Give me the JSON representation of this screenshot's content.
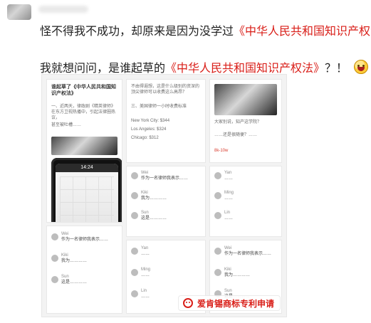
{
  "post": {
    "line1": "怪不得我不成功，却原来是因为没学过",
    "line1_red": "《中华人民共和国知识产权法》",
    "line2": "我就想问问，是谁起草的",
    "line2_red": "《中华人民共和国知识产权法》",
    "line2_tail": "？！"
  },
  "icons": {
    "avatar": "avatar",
    "emoji_1": "grinning-face-icon",
    "emoji_2": "laughing-face-icon",
    "emoji_3": "laughing-face-icon",
    "watermark": "wechat-icon"
  },
  "collage": {
    "tile_a": {
      "title": "谁起草了《中华人民共和国知识产权法》",
      "p1": "一、近两天，律政剧《精英律师》在东方卫视热播中，引起法律圈热议，",
      "p2": "甚至被吐槽……"
    },
    "tile_b": {
      "q": "不由得遐想，这是什么级别的资深的顶尖律师可以收费这么高昂？",
      "s": "三、美国律师一小时收费标准",
      "list": [
        "New York City: $344",
        "Los Angeles: $324",
        "Chicago: $312"
      ]
    },
    "tile_c": {
      "p1": "大家别说，知产这学院？",
      "p2": "……还是很随便？……",
      "hl": "8k-10w"
    },
    "phone": {
      "time": "14:24"
    },
    "comments": [
      {
        "name": "Wei",
        "msg": "作为一名律师我表示……"
      },
      {
        "name": "Kiki",
        "msg": "我为…………"
      },
      {
        "name": "Sun",
        "msg": "这是…………"
      },
      {
        "name": "Yan",
        "msg": "……"
      },
      {
        "name": "Ming",
        "msg": "……"
      },
      {
        "name": "Lin",
        "msg": "……"
      }
    ]
  },
  "watermark": {
    "text": "爱肯锡商标专利申请"
  },
  "colors": {
    "red": "#d91e18"
  }
}
